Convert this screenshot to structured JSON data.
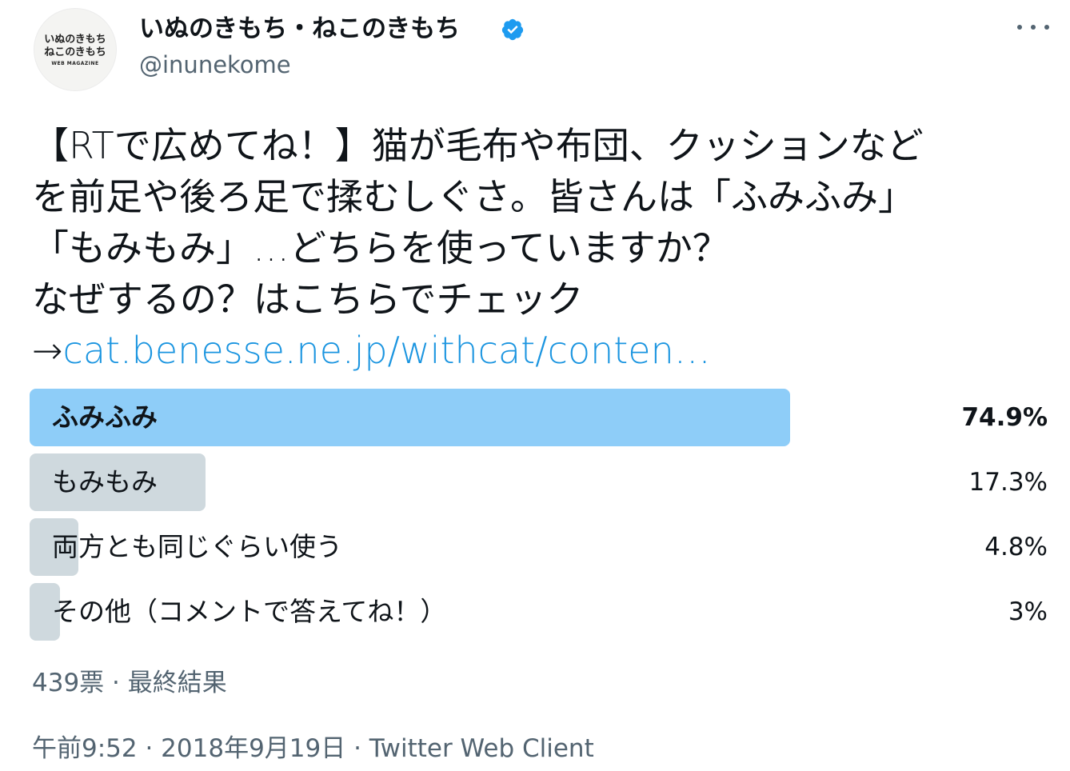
{
  "account": {
    "display_name": "いぬのきもち・ねこのきもち",
    "handle": "@inunekome",
    "avatar_line1": "いぬのきもち",
    "avatar_line2": "ねこのきもち",
    "avatar_line3": "WEB MAGAZINE",
    "verified_icon": "verified-badge-icon",
    "more_icon": "more-options-icon"
  },
  "tweet": {
    "line1": "【RTで広めてね！】猫が毛布や布団、クッションなど",
    "line2": "を前足や後ろ足で揉むしぐさ。皆さんは「ふみふみ」",
    "line3": "「もみもみ」…どちらを使っていますか？",
    "line4": "なぜするの？はこちらでチェック",
    "arrow": "→",
    "link": "cat.benesse.ne.jp/withcat/conten…"
  },
  "poll": {
    "options": [
      {
        "label": "ふみふみ",
        "percent_text": "74.9%",
        "percent": 74.9,
        "winner": true
      },
      {
        "label": "もみもみ",
        "percent_text": "17.3%",
        "percent": 17.3,
        "winner": false
      },
      {
        "label": "両方とも同じぐらい使う",
        "percent_text": "4.8%",
        "percent": 4.8,
        "winner": false
      },
      {
        "label": "その他（コメントで答えてね！）",
        "percent_text": "3%",
        "percent": 3,
        "winner": false
      }
    ],
    "meta": "439票 · 最終結果"
  },
  "timestamp": "午前9:52 · 2018年9月19日 · Twitter Web Client",
  "colors": {
    "winner_bar": "#8ecdf8",
    "other_bar": "#cfd9de",
    "link": "#1b95e0",
    "muted_text": "#536471",
    "verified": "#1d9bf0"
  }
}
